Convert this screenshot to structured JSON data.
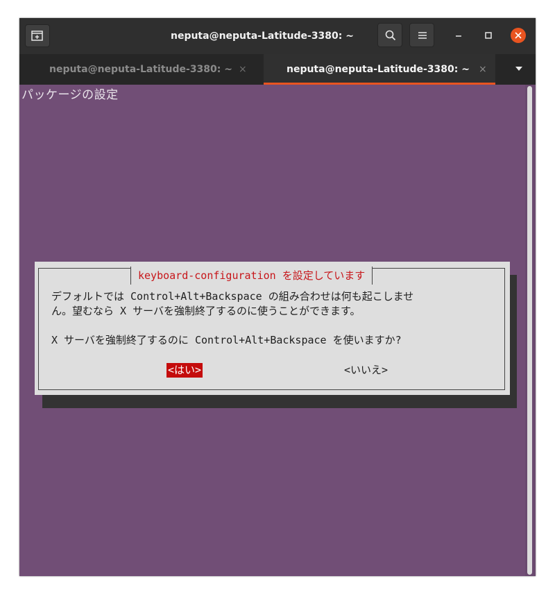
{
  "window": {
    "title": "neputa@neputa-Latitude-3380: ~"
  },
  "tabs": [
    {
      "label": "neputa@neputa-Latitude-3380: ~",
      "close": "×",
      "active": false
    },
    {
      "label": "neputa@neputa-Latitude-3380: ~",
      "close": "×",
      "active": true
    }
  ],
  "terminal": {
    "heading": "パッケージの設定"
  },
  "dialog": {
    "title": "keyboard-configuration を設定しています",
    "line1": "デフォルトでは Control+Alt+Backspace の組み合わせは何も起こしませ",
    "line2": "ん。望むなら X サーバを強制終了するのに使うことができます。",
    "line3": "X サーバを強制終了するのに Control+Alt+Backspace を使いますか?",
    "yes_label": "<はい>",
    "no_label": "<いいえ>"
  },
  "colors": {
    "accent": "#e95420",
    "terminal_bg": "#714e76",
    "dialog_bg": "#dedede",
    "dialog_title": "#c7161a",
    "selected_button": "#c40c0c"
  },
  "icons": [
    "new-tab-icon",
    "search-icon",
    "hamburger-menu-icon",
    "minimize-icon",
    "maximize-icon",
    "close-icon",
    "tab-list-dropdown-icon"
  ]
}
